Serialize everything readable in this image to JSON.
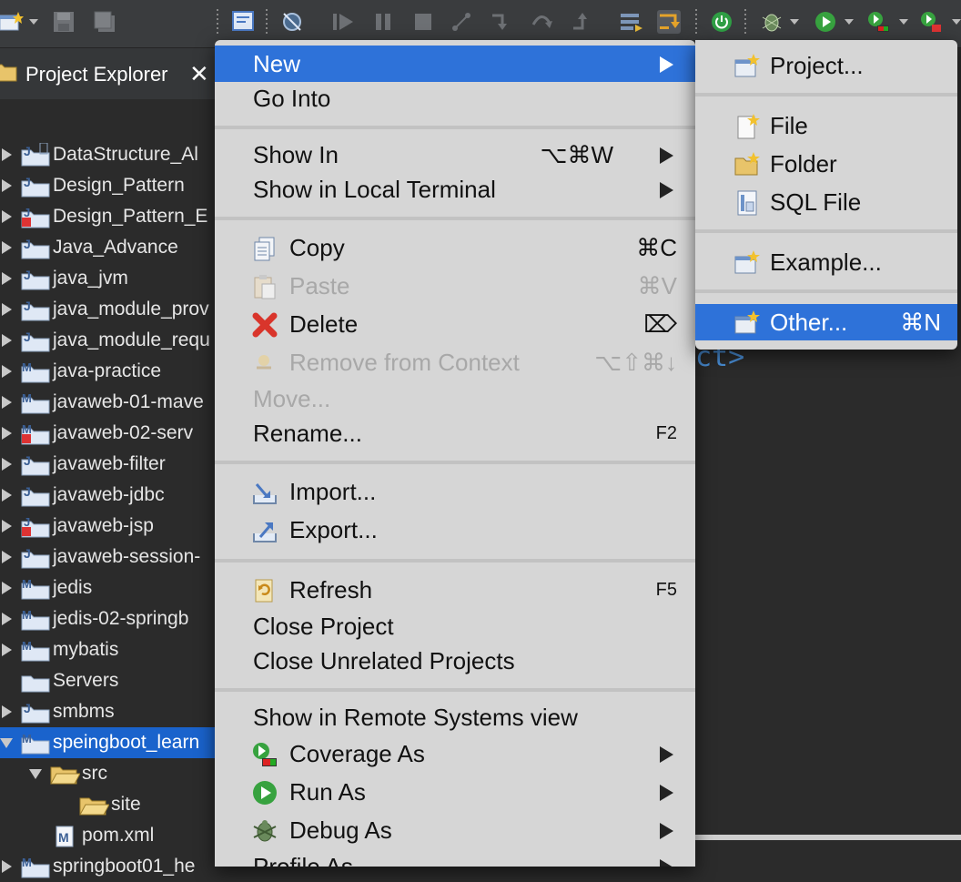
{
  "toolbar": {
    "icons": [
      "new-wizard-icon",
      "save-icon",
      "save-all-icon",
      "toggle-breadcrumb-icon",
      "skip-breakpoints-icon",
      "resume-icon",
      "suspend-icon",
      "terminate-icon",
      "disconnect-icon",
      "step-into-icon",
      "step-over-icon",
      "step-return-icon",
      "drop-to-frame-icon",
      "use-step-filters-icon",
      "power-icon",
      "debug-icon",
      "run-icon",
      "coverage-icon",
      "external-tools-icon"
    ]
  },
  "explorer": {
    "title": "Project Explorer",
    "close_glyph": "✕",
    "items": [
      {
        "label": "DataStructure_Al"
      },
      {
        "label": "Design_Pattern"
      },
      {
        "label": "Design_Pattern_E"
      },
      {
        "label": "Java_Advance"
      },
      {
        "label": "java_jvm"
      },
      {
        "label": "java_module_prov"
      },
      {
        "label": "java_module_requ"
      },
      {
        "label": "java-practice"
      },
      {
        "label": "javaweb-01-mave"
      },
      {
        "label": "javaweb-02-serv"
      },
      {
        "label": "javaweb-filter"
      },
      {
        "label": "javaweb-jdbc"
      },
      {
        "label": "javaweb-jsp"
      },
      {
        "label": "javaweb-session-"
      },
      {
        "label": "jedis"
      },
      {
        "label": "jedis-02-springb"
      },
      {
        "label": "mybatis"
      },
      {
        "label": "Servers"
      },
      {
        "label": "smbms"
      },
      {
        "label": "speingboot_learn"
      },
      {
        "label": "src"
      },
      {
        "label": "site"
      },
      {
        "label": "pom.xml"
      },
      {
        "label": "springboot01_he"
      }
    ]
  },
  "editor": {
    "fragment": "ct>"
  },
  "menu": {
    "new": {
      "label": "New"
    },
    "go_into": {
      "label": "Go Into"
    },
    "show_in": {
      "label": "Show In",
      "shortcut": "⌥⌘W"
    },
    "show_local_terminal": {
      "label": "Show in Local Terminal"
    },
    "copy": {
      "label": "Copy",
      "shortcut": "⌘C"
    },
    "paste": {
      "label": "Paste",
      "shortcut": "⌘V"
    },
    "delete": {
      "label": "Delete",
      "shortcut": "⌦"
    },
    "remove_context": {
      "label": "Remove from Context",
      "shortcut": "⌥⇧⌘↓"
    },
    "move": {
      "label": "Move..."
    },
    "rename": {
      "label": "Rename...",
      "shortcut": "F2"
    },
    "import": {
      "label": "Import..."
    },
    "export": {
      "label": "Export..."
    },
    "refresh": {
      "label": "Refresh",
      "shortcut": "F5"
    },
    "close_project": {
      "label": "Close Project"
    },
    "close_unrelated": {
      "label": "Close Unrelated Projects"
    },
    "show_remote": {
      "label": "Show in Remote Systems view"
    },
    "coverage_as": {
      "label": "Coverage As"
    },
    "run_as": {
      "label": "Run As"
    },
    "debug_as": {
      "label": "Debug As"
    },
    "profile_as": {
      "label": "Profile As"
    }
  },
  "submenu": {
    "project": {
      "label": "Project..."
    },
    "file": {
      "label": "File"
    },
    "folder": {
      "label": "Folder"
    },
    "sql_file": {
      "label": "SQL File"
    },
    "example": {
      "label": "Example..."
    },
    "other": {
      "label": "Other...",
      "shortcut": "⌘N"
    }
  },
  "colors": {
    "menu_bg": "#d6d6d6",
    "highlight": "#2e72d9",
    "tree_selected": "#1a63cc"
  }
}
